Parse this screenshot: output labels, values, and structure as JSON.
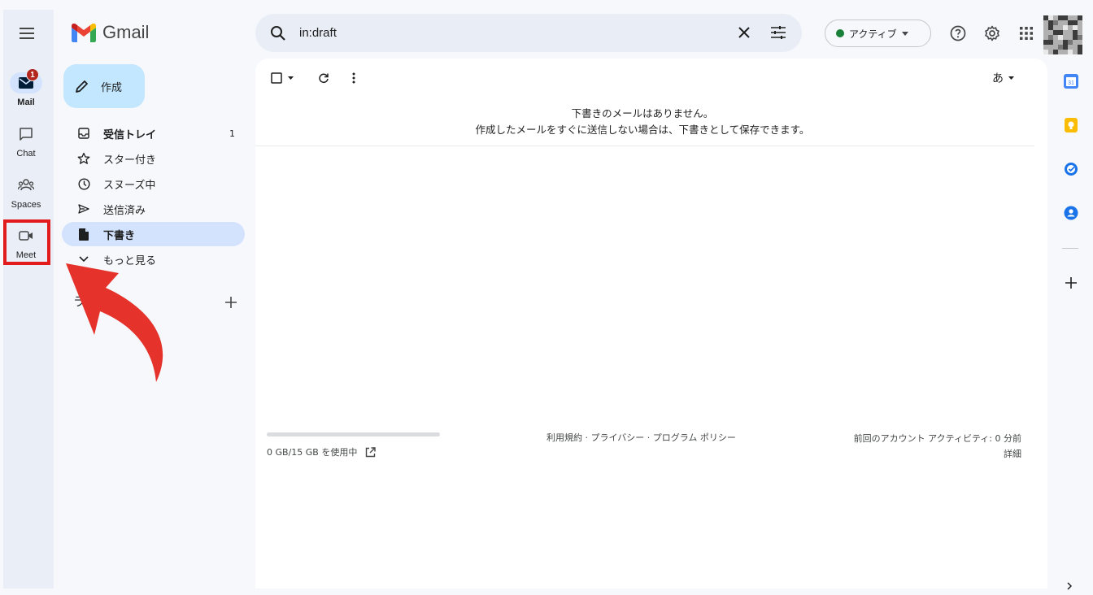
{
  "app": {
    "title": "Gmail"
  },
  "rail": {
    "items": [
      {
        "label": "Mail",
        "icon": "mail-icon",
        "badge": "1",
        "active": true
      },
      {
        "label": "Chat",
        "icon": "chat-icon"
      },
      {
        "label": "Spaces",
        "icon": "spaces-icon"
      },
      {
        "label": "Meet",
        "icon": "meet-icon",
        "highlighted": true
      }
    ]
  },
  "compose": {
    "label": "作成"
  },
  "nav": {
    "items": [
      {
        "label": "受信トレイ",
        "count": "1",
        "icon": "inbox-icon"
      },
      {
        "label": "スター付き",
        "icon": "star-icon"
      },
      {
        "label": "スヌーズ中",
        "icon": "clock-icon"
      },
      {
        "label": "送信済み",
        "icon": "send-icon"
      },
      {
        "label": "下書き",
        "icon": "draft-icon",
        "active": true
      },
      {
        "label": "もっと見る",
        "icon": "chevron-down-icon"
      }
    ],
    "labels_heading": "ラ"
  },
  "search": {
    "value": "in:draft"
  },
  "status": {
    "label": "アクティブ",
    "color": "#188038"
  },
  "toolbar": {
    "ime_label": "あ"
  },
  "empty_state": {
    "line1": "下書きのメールはありません。",
    "line2": "作成したメールをすぐに送信しない場合は、下書きとして保存できます。"
  },
  "footer": {
    "storage": "0 GB/15 GB を使用中",
    "storage_used_fraction": 0,
    "links": "利用規約 · プライバシー · プログラム ポリシー",
    "activity": "前回のアカウント アクティビティ: 0 分前",
    "details": "詳細"
  },
  "side_panel": {
    "calendar_day": "31",
    "icons": [
      "calendar-icon",
      "keep-icon",
      "tasks-icon",
      "contacts-icon",
      "add-icon"
    ]
  },
  "colors": {
    "accent": "#c2e7ff",
    "active_nav": "#d3e3fd",
    "highlight_box": "#e21c1c",
    "arrow": "#e5322a"
  }
}
